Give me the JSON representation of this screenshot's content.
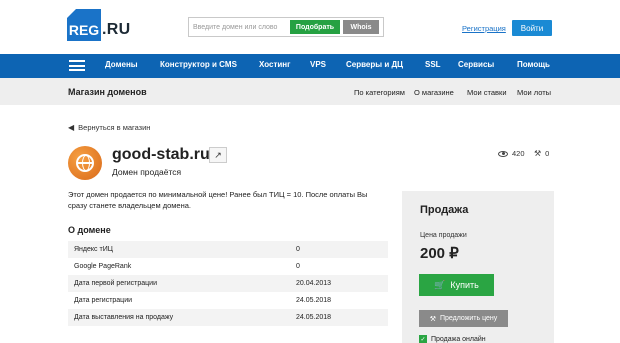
{
  "header": {
    "logo_text": "REG",
    "logo_suffix": ".RU",
    "search_placeholder": "Введите домен или слово",
    "pick_button": "Подобрать",
    "whois_button": "Whois",
    "register_link": "Регистрация",
    "login_button": "Войти"
  },
  "nav": {
    "items": [
      "Домены",
      "Конструктор и CMS",
      "Хостинг",
      "VPS",
      "Серверы и ДЦ",
      "SSL",
      "Сервисы",
      "Помощь"
    ]
  },
  "subbar": {
    "title": "Магазин доменов",
    "links": [
      "По категориям",
      "О магазине",
      "Мои ставки",
      "Мои лоты"
    ]
  },
  "back_link": "Вернуться в магазин",
  "domain": {
    "name": "good-stab.ru",
    "status": "Домен продаётся",
    "views": "420",
    "bids": "0",
    "description": "Этот домен продается по минимальной цене! Ранее был ТИЦ = 10. После оплаты Вы сразу станете владельцем домена."
  },
  "about": {
    "title": "О домене",
    "rows": [
      {
        "label": "Яндекс тИЦ",
        "value": "0"
      },
      {
        "label": "Google PageRank",
        "value": "0"
      },
      {
        "label": "Дата первой регистрации",
        "value": "20.04.2013"
      },
      {
        "label": "Дата регистрации",
        "value": "24.05.2018"
      },
      {
        "label": "Дата выставления на продажу",
        "value": "24.05.2018"
      }
    ]
  },
  "sale": {
    "title": "Продажа",
    "price_label": "Цена продажи",
    "price": "200 ₽",
    "buy_button": "Купить",
    "offer_button": "Предложить цену",
    "online_label": "Продажа онлайн"
  },
  "colors": {
    "nav_blue": "#0d64b3",
    "green": "#2aa543",
    "gray_button": "#8a8a8a",
    "link_blue": "#1a73c8"
  }
}
